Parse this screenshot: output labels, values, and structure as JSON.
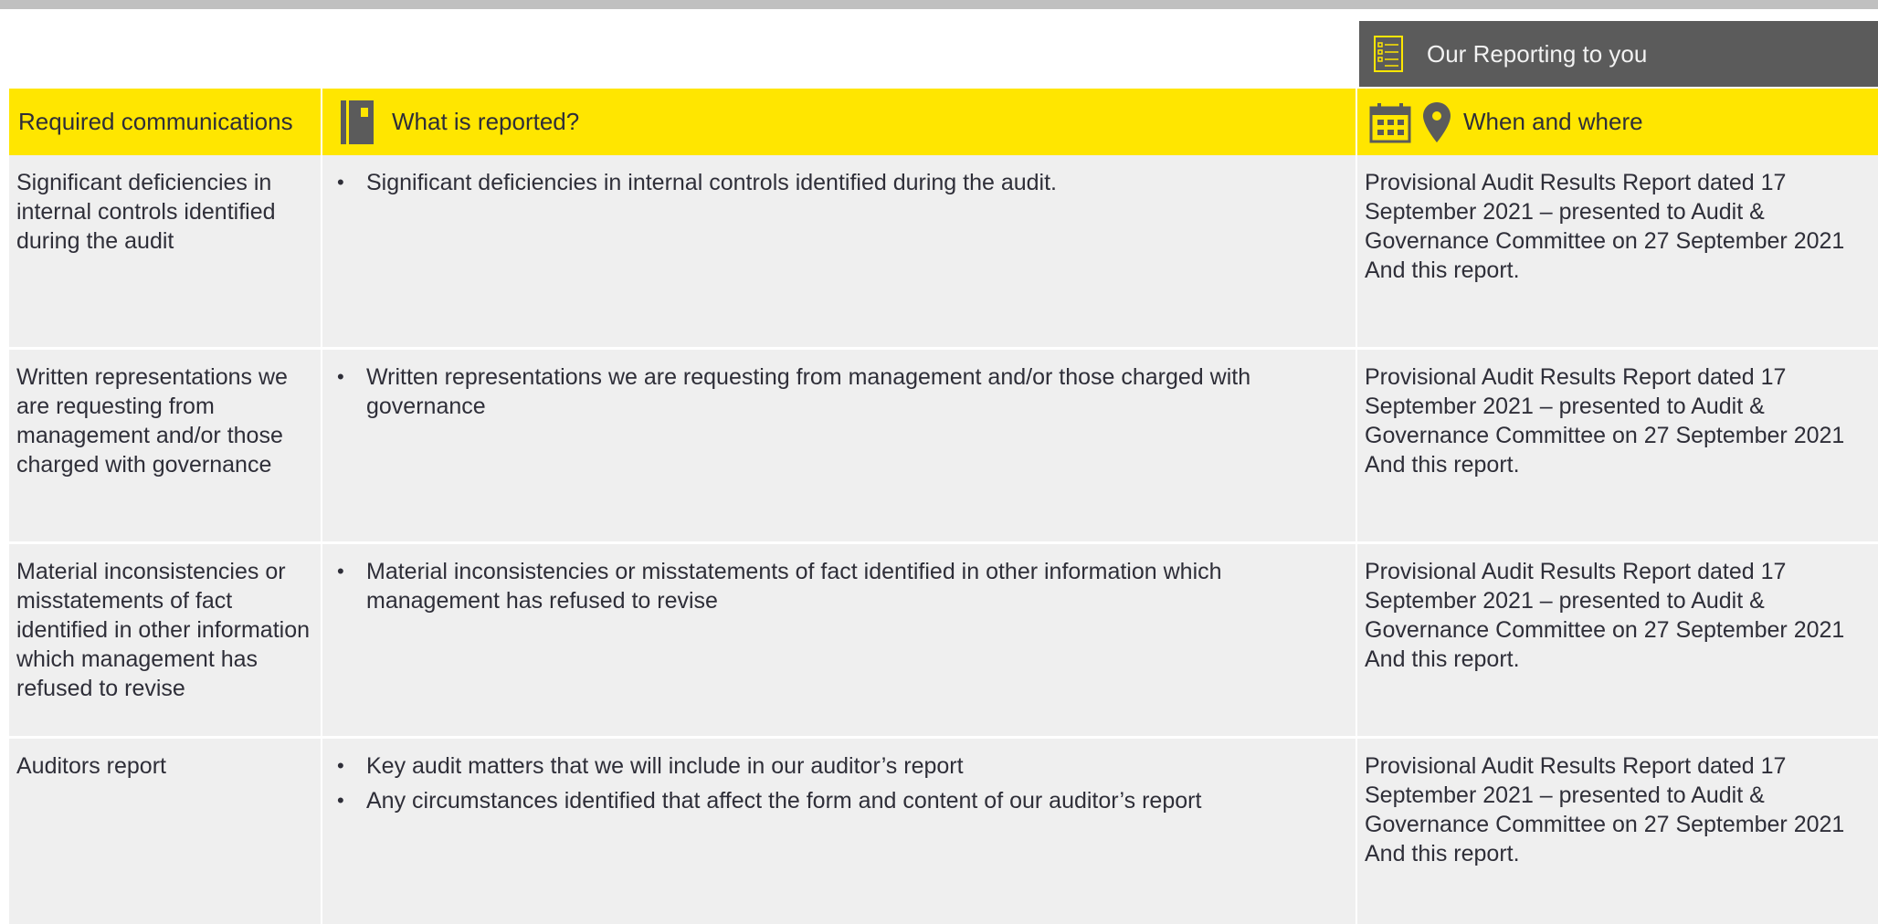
{
  "header": {
    "reporting_title": "Our Reporting to you",
    "col1": "Required communications",
    "col2": "What is reported?",
    "col3": "When and where"
  },
  "rows": [
    {
      "communication": "Significant deficiencies in internal controls identified during the audit",
      "reported": [
        "Significant deficiencies in internal controls identified during the audit."
      ],
      "when_lines": [
        "Provisional Audit Results Report dated 17 September 2021 – presented to Audit & Governance Committee on 27 September 2021",
        "And this report."
      ]
    },
    {
      "communication": "Written representations we are requesting from management and/or those charged with governance",
      "reported": [
        "Written representations we are requesting from management and/or those charged with governance"
      ],
      "when_lines": [
        "Provisional Audit Results Report dated 17 September 2021 – presented to Audit & Governance Committee on 27 September 2021",
        "And this report."
      ]
    },
    {
      "communication": "Material inconsistencies or misstatements of fact identified in other information which management has refused to revise",
      "reported": [
        "Material inconsistencies or misstatements of fact identified in other information which management has refused to revise"
      ],
      "when_lines": [
        "Provisional Audit Results Report dated 17 September 2021 – presented to Audit & Governance Committee on 27 September 2021",
        "And this report."
      ]
    },
    {
      "communication": "Auditors report",
      "reported": [
        "Key audit matters that we will include in our auditor’s report",
        "Any circumstances identified that affect the form and content of our auditor’s report"
      ],
      "when_lines": [
        "Provisional Audit Results Report dated 17 September 2021 – presented to Audit & Governance Committee on 27 September 2021",
        "And this report."
      ]
    }
  ],
  "colors": {
    "accent": "#ffe600",
    "header_bar": "#5b5b5b",
    "row_bg": "#efefef",
    "text": "#2e2e38"
  },
  "icons": [
    "checklist-icon",
    "notebook-icon",
    "calendar-icon",
    "location-pin-icon"
  ]
}
